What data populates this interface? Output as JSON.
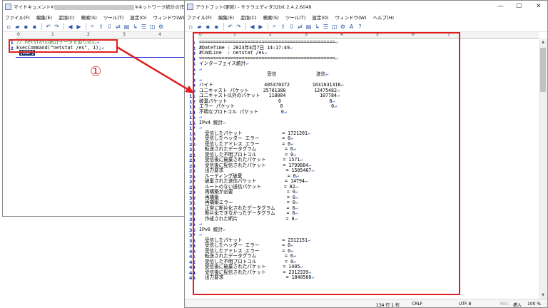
{
  "left_window": {
    "title_prefix": "マイドキュメント¥",
    "title_suffix": "¥ネットワーク統計の作",
    "menu": [
      "ファイル(F)",
      "編集(E)",
      "変換(C)",
      "検索(S)",
      "ツール(T)",
      "設定(O)",
      "ウィンドウ(W)",
      "ヘ"
    ],
    "ruler": [
      "0",
      "1",
      "2",
      "3",
      "4"
    ],
    "line_numbers": [
      "1",
      "2"
    ],
    "lines": [
      "// netstatの統計データを取り込む",
      "ExecCommand(\"netstat /es\", 1);"
    ],
    "eof_marker": "[EOF]",
    "annotation": "①"
  },
  "right_window": {
    "title": "アウトプット(更新) - サクラエディタ32bit 2.4.2.6048",
    "menu": [
      "ファイル(F)",
      "編集(E)",
      "変換(C)",
      "検索(S)",
      "ツール(T)",
      "設定(O)",
      "ウィンドウ(W)",
      "ヘルプ(H)"
    ],
    "ruler": [
      "0",
      "1",
      "2",
      "3",
      "4",
      "5",
      "6",
      "7"
    ],
    "status": {
      "position": "134 行    1 桁",
      "newline": "CRLF",
      "encoding": "UTF-8",
      "rec": "REC",
      "insert": "挿入",
      "zoom": "100 %"
    },
    "annotation": "②",
    "lines": [
      {
        "n": "1",
        "t": "================================================"
      },
      {
        "n": "2",
        "t": "#DateTime : 2023年4月7日 14:17:49"
      },
      {
        "n": "3",
        "t": "#CmdLine  : netstat /es"
      },
      {
        "n": "4",
        "t": "================================================"
      },
      {
        "n": "5",
        "t": "インターフェイス統計"
      },
      {
        "n": "6",
        "t": ""
      },
      {
        "n": "7",
        "t": "                        受信              送信"
      },
      {
        "n": "8",
        "t": ""
      },
      {
        "n": "9",
        "t": "バイト                  405370372        1631631316"
      },
      {
        "n": "10",
        "t": "ユニキャスト パケット     25701380          12475482"
      },
      {
        "n": "11",
        "t": "ユニキャスト以外のパケット   118084            107784"
      },
      {
        "n": "12",
        "t": "破棄パケット                  0                 0"
      },
      {
        "n": "13",
        "t": "エラー パケット                0                 0"
      },
      {
        "n": "14",
        "t": "不明なプロトコル パケット        0"
      },
      {
        "n": "15",
        "t": ""
      },
      {
        "n": "16",
        "t": "IPv4 統計"
      },
      {
        "n": "17",
        "t": ""
      },
      {
        "n": "18",
        "t": "  受信したパケット              = 1721201"
      },
      {
        "n": "19",
        "t": "  受信したヘッダー エラー        = 0"
      },
      {
        "n": "20",
        "t": "  受信したアドレス エラー        = 0"
      },
      {
        "n": "21",
        "t": "  転送されたデータグラム          = 0"
      },
      {
        "n": "22",
        "t": "  受信した不明プロトコル          = 0"
      },
      {
        "n": "23",
        "t": "  受信後に破棄されたパケット      = 1571"
      },
      {
        "n": "24",
        "t": "  受信後に配信されたパケット      = 1799884"
      },
      {
        "n": "25",
        "t": "  出力要求                      = 1505467"
      },
      {
        "n": "26",
        "t": "  ルーティング破棄                = 0"
      },
      {
        "n": "27",
        "t": "  破棄された送信パケット          = 14794"
      },
      {
        "n": "28",
        "t": "  ルートのない送信パケット        = 82"
      },
      {
        "n": "29",
        "t": "  再構築が必要                   = 0"
      },
      {
        "n": "30",
        "t": "  再構築                        = 0"
      },
      {
        "n": "31",
        "t": "  再構築エラー                   = 0"
      },
      {
        "n": "32",
        "t": "  正常に断片化されたデータグラム    = 0"
      },
      {
        "n": "33",
        "t": "  断片化できなかったデータグラム    = 0"
      },
      {
        "n": "34",
        "t": "  作成された断片                 = 0"
      },
      {
        "n": "35",
        "t": ""
      },
      {
        "n": "36",
        "t": "IPv6 統計"
      },
      {
        "n": "37",
        "t": ""
      },
      {
        "n": "38",
        "t": "  受信したパケット              = 2312151"
      },
      {
        "n": "39",
        "t": "  受信したヘッダー エラー        = 0"
      },
      {
        "n": "40",
        "t": "  受信したアドレス エラー        = 0"
      },
      {
        "n": "41",
        "t": "  転送されたデータグラム          = 0"
      },
      {
        "n": "42",
        "t": "  受信した不明プロトコル          = 0"
      },
      {
        "n": "43",
        "t": "  受信後に破棄されたパケット      = 1405"
      },
      {
        "n": "44",
        "t": "  受信後に配信されたパケット      = 2312339"
      },
      {
        "n": "45",
        "t": "  出力要求                      = 1840566"
      }
    ]
  },
  "toolbar_icons": [
    "new-file-icon",
    "open-folder-icon",
    "save-icon",
    "save-all-icon",
    "undo-icon",
    "redo-icon",
    "back-icon",
    "forward-icon",
    "search-icon",
    "search-prev-icon",
    "search-next-icon",
    "replace-icon",
    "grep-icon",
    "jump-icon",
    "outline-icon",
    "compare-icon",
    "settings-icon",
    "font-icon",
    "help-icon"
  ],
  "colors": {
    "annotation_red": "#e01f1f",
    "line_number_blue": "#1b3bb5",
    "comment_green": "#1e7a1e",
    "eof_bg": "#173a6a"
  }
}
